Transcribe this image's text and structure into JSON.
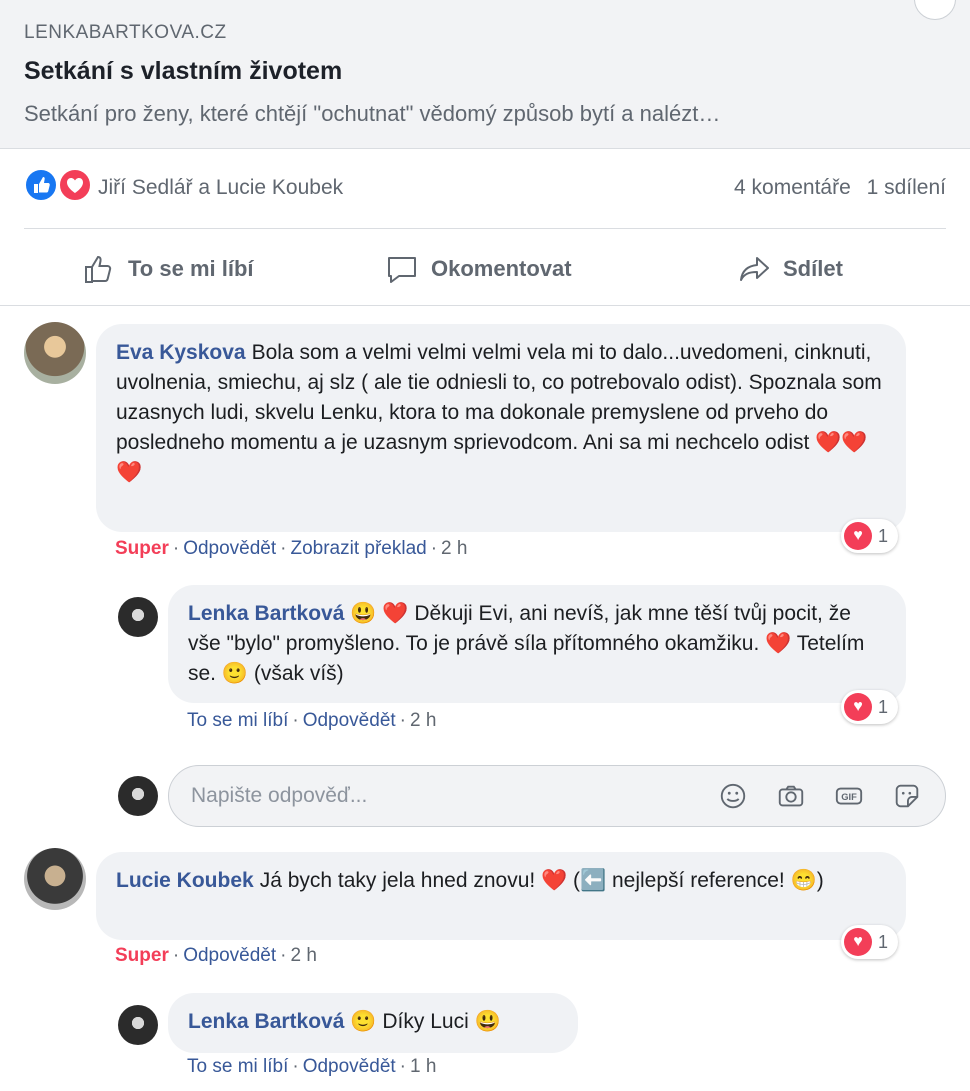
{
  "link_preview": {
    "source": "LENKABARTKOVA.CZ",
    "title": "Setkání s vlastním životem",
    "description": "Setkání pro ženy, které chtějí \"ochutnat\" vědomý způsob bytí a nalézt…"
  },
  "reactions": {
    "names": "Jiří Sedlář a Lucie Koubek",
    "comments_count": "4 komentáře",
    "shares_count": "1 sdílení",
    "like_color": "#1877f2",
    "love_color": "#f33e58"
  },
  "actions": {
    "like": "To se mi líbí",
    "comment": "Okomentovat",
    "share": "Sdílet"
  },
  "comments": [
    {
      "author": "Eva Kyskova",
      "text": "Bola som a velmi velmi velmi vela mi to dalo...uvedomeni, cinknuti, uvolnenia, smiechu, aj slz ( ale tie odniesli to, co potrebovalo odist). Spoznala som uzasnych ludi, skvelu Lenku, ktora to ma dokonale premyslene od prveho do posledneho momentu a je uzasnym sprievodcom. Ani sa mi nechcelo odist ",
      "trailing_emoji": "❤️❤️❤️",
      "reaction_label": "Super",
      "reply": "Odpovědět",
      "translate": "Zobrazit překlad",
      "time": "2 h",
      "reaction_count": "1"
    },
    {
      "author": "Lenka Bartková",
      "text_a": "😃 ❤️ Děkuji Evi, ani nevíš, jak mne těší tvůj pocit, že vše \"bylo\" promyšleno. To je právě síla přítomného okamžiku. ",
      "text_b": "❤️",
      "text_c": " Tetelím se. 🙂 (však víš)",
      "like": "To se mi líbí",
      "reply": "Odpovědět",
      "time": "2 h",
      "reaction_count": "1"
    },
    {
      "author": "Lucie Koubek",
      "text": "Já bych taky jela hned znovu! ❤️ (⬅️ nejlepší reference! 😁)",
      "reaction_label": "Super",
      "reply": "Odpovědět",
      "time": "2 h",
      "reaction_count": "1"
    },
    {
      "author": "Lenka Bartková",
      "text": "🙂 Díky Luci 😃",
      "like": "To se mi líbí",
      "reply": "Odpovědět",
      "time": "1 h"
    }
  ],
  "reply_input": {
    "placeholder": "Napište odpověď..."
  },
  "input_icons": [
    "emoji-icon",
    "camera-icon",
    "gif-icon",
    "sticker-icon"
  ],
  "input_icon_labels": {
    "gif": "GIF"
  }
}
